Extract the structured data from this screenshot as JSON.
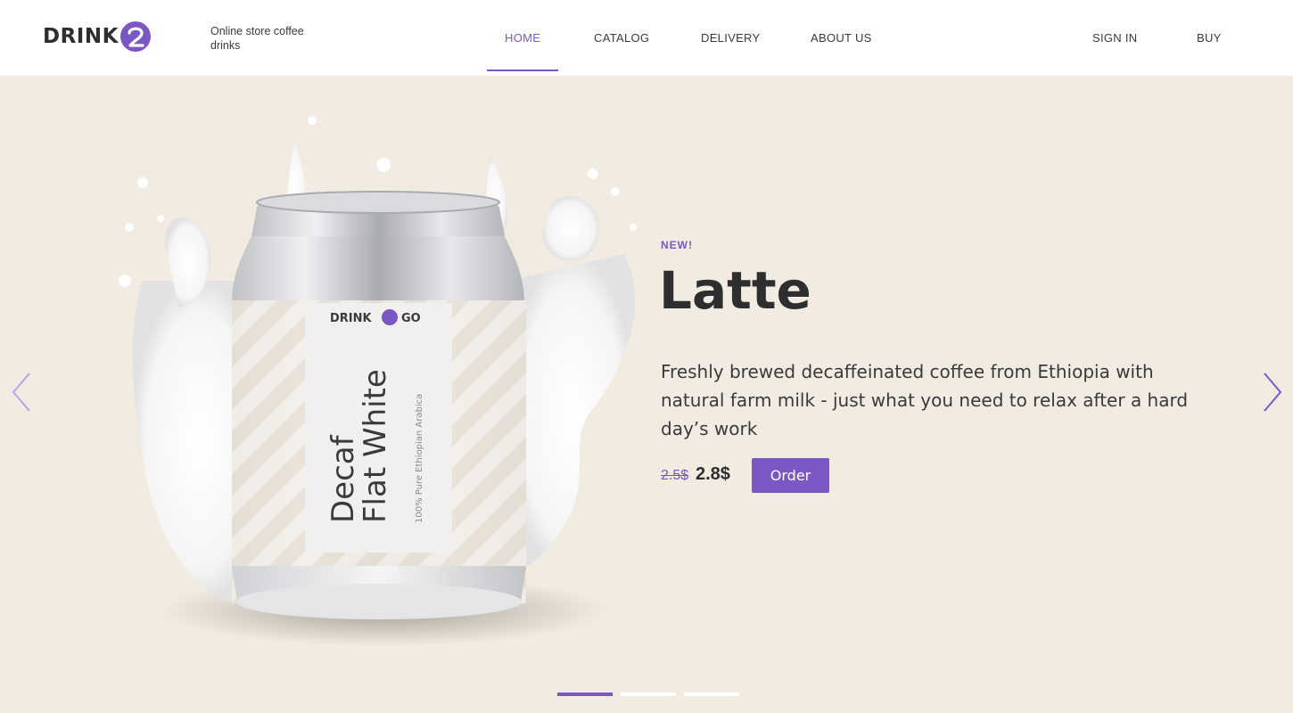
{
  "header": {
    "logo_text": "DRINK",
    "tagline": "Online store coffee drinks",
    "nav": [
      {
        "label": "HOME"
      },
      {
        "label": "CATALOG"
      },
      {
        "label": "DELIVERY"
      },
      {
        "label": "ABOUT US"
      }
    ],
    "sign_in": "SIGN IN",
    "buy": "BUY"
  },
  "hero": {
    "badge": "NEW!",
    "title": "Latte",
    "description": "Freshly brewed decaffeinated coffee from Ethiopia with natural farm milk - just what you need to relax after a hard day’s work",
    "old_price": "2.5$",
    "new_price": "2.8$",
    "order_label": "Order",
    "can": {
      "brand_left": "DRINK",
      "brand_right": "GO",
      "name_line1": "Decaf",
      "name_line2": "Flat White",
      "sub_label": "100% Pure Ethiopian Arabica"
    },
    "slides": {
      "count": 3,
      "active_index": 0
    }
  },
  "colors": {
    "accent": "#7a57c4",
    "hero_bg": "#f2ebe2",
    "text": "#2e2e2e"
  },
  "icons": {
    "prev": "chevron-left-icon",
    "next": "chevron-right-icon",
    "logo_mark": "number-two-logo-icon"
  }
}
